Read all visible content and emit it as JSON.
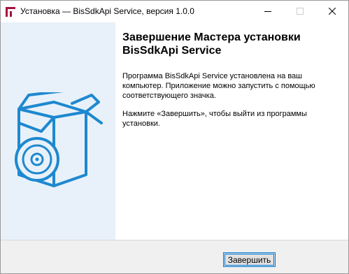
{
  "window": {
    "title": "Установка — BisSdkApi Service, версия 1.0.0",
    "icons": [
      "setup-app-icon",
      "minimize-icon",
      "maximize-icon",
      "close-icon"
    ]
  },
  "side_panel": {
    "image": "software-box-with-disc"
  },
  "content": {
    "heading": "Завершение Мастера установки BisSdkApi Service",
    "paragraph1": "Программа BisSdkApi Service установлена на ваш компьютер. Приложение можно запустить с помощью соответствующего значка.",
    "paragraph2": "Нажмите «Завершить», чтобы выйти из программы установки."
  },
  "footer": {
    "finish_label": "Завершить"
  },
  "colors": {
    "accent": "#0078d7",
    "side_panel": "#e8f1f9",
    "box_stroke": "#1e88d0",
    "app_icon": "#a4133c"
  }
}
